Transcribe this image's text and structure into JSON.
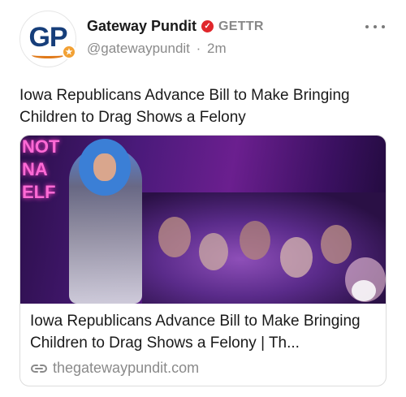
{
  "author": {
    "avatar_text": "GP",
    "display_name": "Gateway Pundit",
    "platform": "GETTR",
    "handle": "@gatewaypundit",
    "separator": "·",
    "time": "2m"
  },
  "post": {
    "text": "Iowa Republicans Advance Bill to Make Bringing Children to Drag Shows a Felony"
  },
  "link_card": {
    "image_neon_text": "NOT\nNA\nELF",
    "title": "Iowa Republicans Advance Bill to Make Bringing Children to Drag Shows a Felony | Th...",
    "source": "thegatewaypundit.com"
  },
  "icons": {
    "more": "more-horizontal-icon",
    "verified": "verified-check-icon",
    "link": "link-icon"
  },
  "colors": {
    "verified_red": "#e0262b",
    "avatar_blue": "#163e7a",
    "avatar_orange": "#e07a1a",
    "muted_text": "#8a8a8a"
  }
}
